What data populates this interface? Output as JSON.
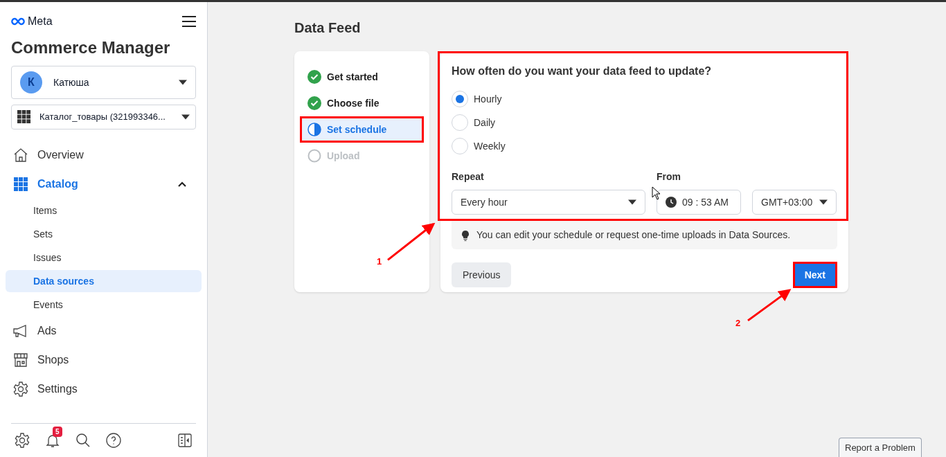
{
  "sidebar": {
    "brand": "Meta",
    "app_title": "Commerce Manager",
    "account": {
      "initial": "К",
      "name": "Катюша"
    },
    "catalog": {
      "name": "Каталог_товары (321993346..."
    },
    "nav": [
      {
        "label": "Overview",
        "kind": "home"
      },
      {
        "label": "Catalog",
        "kind": "catalog",
        "expanded": true,
        "children": [
          {
            "label": "Items",
            "selected": false
          },
          {
            "label": "Sets",
            "selected": false
          },
          {
            "label": "Issues",
            "selected": false
          },
          {
            "label": "Data sources",
            "selected": true
          },
          {
            "label": "Events",
            "selected": false
          }
        ]
      },
      {
        "label": "Ads",
        "kind": "ads"
      },
      {
        "label": "Shops",
        "kind": "shops"
      },
      {
        "label": "Settings",
        "kind": "settings"
      }
    ],
    "notification_count": "5"
  },
  "page_title": "Data Feed",
  "steps": [
    {
      "label": "Get started",
      "done": true,
      "selected": false,
      "annotated": false
    },
    {
      "label": "Choose file",
      "done": true,
      "selected": false,
      "annotated": false
    },
    {
      "label": "Set schedule",
      "done": false,
      "selected": true,
      "annotated": true
    },
    {
      "label": "Upload",
      "done": false,
      "selected": false,
      "annotated": false
    }
  ],
  "schedule": {
    "annotated": true,
    "question": "How often do you want your data feed to update?",
    "options": [
      {
        "label": "Hourly",
        "selected": true
      },
      {
        "label": "Daily",
        "selected": false
      },
      {
        "label": "Weekly",
        "selected": false
      }
    ],
    "repeat_label": "Repeat",
    "repeat_value": "Every hour",
    "from_label": "From",
    "time": "09 : 53 AM",
    "timezone": "GMT+03:00"
  },
  "tip": "You can edit your schedule or request one-time uploads in Data Sources.",
  "buttons": {
    "previous": "Previous",
    "next": "Next",
    "next_annotated": true
  },
  "annotations": [
    "1",
    "2"
  ],
  "report_button": "Report a Problem"
}
